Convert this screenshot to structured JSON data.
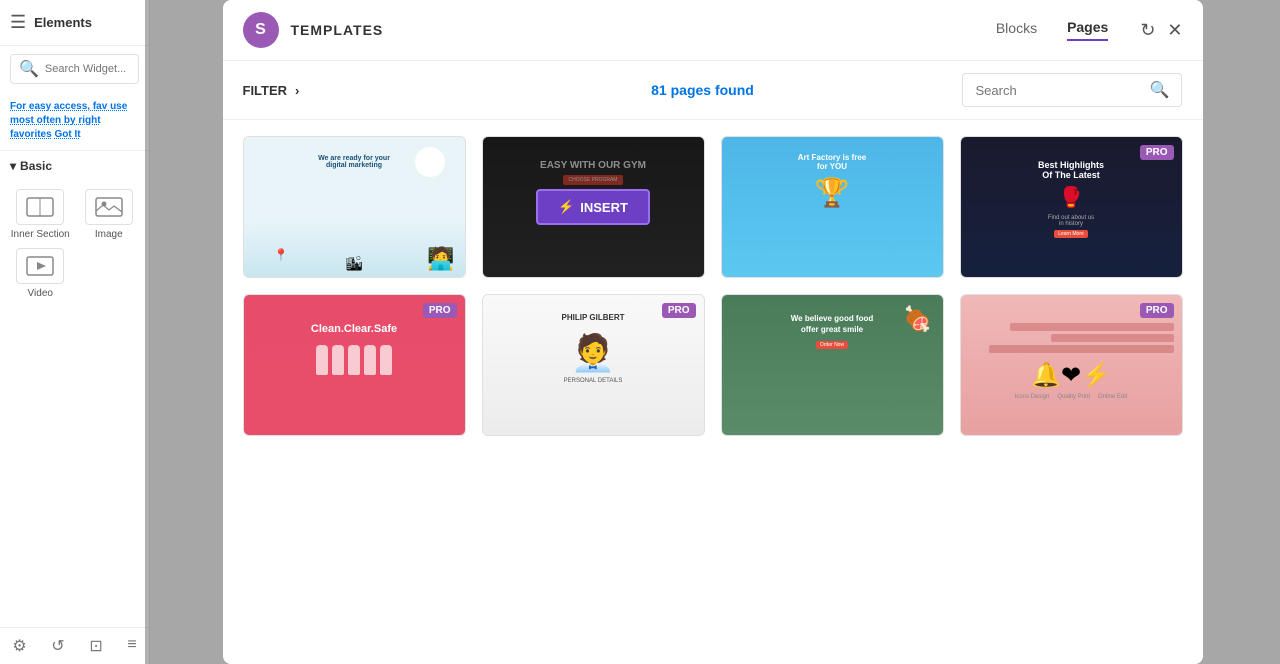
{
  "sidebar": {
    "title": "Elements",
    "search_placeholder": "Search Widget...",
    "hint_text": "For easy access, fav use most often by right favorites",
    "hint_link": "Got It",
    "section_title": "Basic",
    "items": [
      {
        "label": "Inner Section",
        "icon": "⊞"
      },
      {
        "label": "Image",
        "icon": "🖼"
      },
      {
        "label": "Video",
        "icon": "▶"
      }
    ],
    "bottom_icons": [
      "⚙",
      "↺",
      "⊡",
      "≡"
    ]
  },
  "modal": {
    "avatar_letter": "S",
    "title": "TEMPLATES",
    "tabs": [
      {
        "label": "Blocks",
        "active": false
      },
      {
        "label": "Pages",
        "active": true
      }
    ],
    "filter_label": "FILTER",
    "pages_found": "81 pages found",
    "pages_found_number": "81",
    "search_placeholder": "Search",
    "insert_label": "INSERT",
    "pro_label": "PRO",
    "templates": [
      {
        "id": "digital-marketing",
        "type": "digital",
        "hero": "We are ready for your digital marketing",
        "has_pro": false,
        "active_insert": false
      },
      {
        "id": "gym",
        "type": "gym",
        "hero": "EASY WITH OUR GYM",
        "has_pro": false,
        "active_insert": true
      },
      {
        "id": "art-factory",
        "type": "art",
        "hero": "Art Factory is free for YOU",
        "has_pro": false,
        "active_insert": false
      },
      {
        "id": "highlights",
        "type": "dark",
        "hero": "Best Highlights Of The Latest",
        "has_pro": true,
        "active_insert": false
      },
      {
        "id": "clean-clear-safe",
        "type": "clean",
        "hero": "Clean.Clear.Safe",
        "has_pro": true,
        "active_insert": false
      },
      {
        "id": "philip-gilbert",
        "type": "person",
        "hero": "PHILIP GILBERT",
        "has_pro": true,
        "active_insert": false
      },
      {
        "id": "believe-good-food",
        "type": "food",
        "hero": "We believe good food offer great smile",
        "has_pro": false,
        "active_insert": false
      },
      {
        "id": "pink-template",
        "type": "pink",
        "hero": "",
        "has_pro": true,
        "active_insert": false
      }
    ]
  }
}
